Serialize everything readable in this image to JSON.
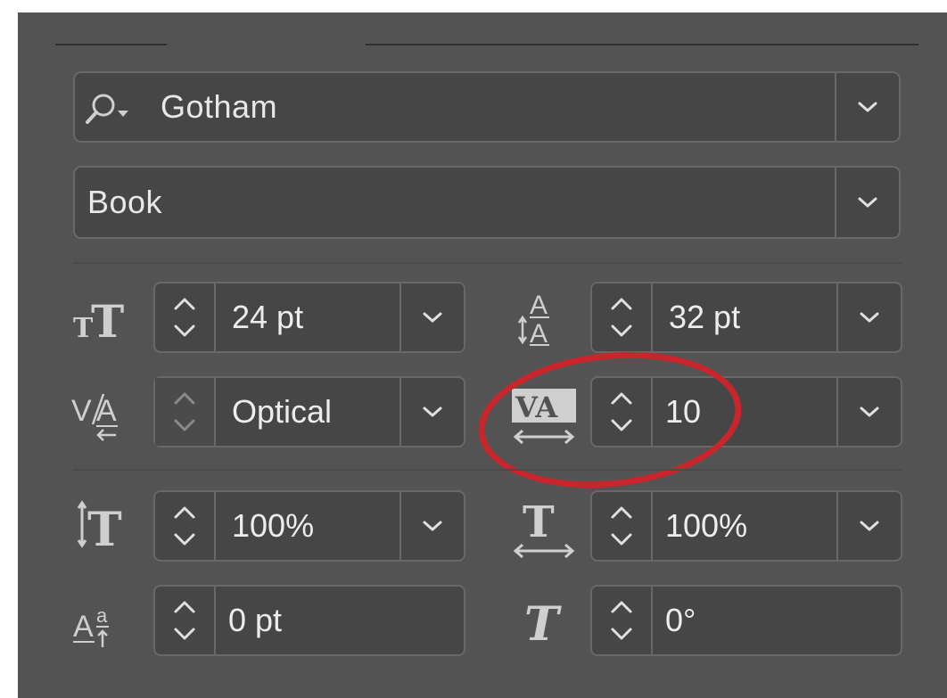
{
  "font_family": {
    "value": "Gotham",
    "icons": {
      "search": "search-dropdown-icon",
      "dropdown": "chevron-down-icon"
    }
  },
  "font_style": {
    "value": "Book"
  },
  "font_size": {
    "value": "24 pt",
    "icon": "font-size-icon"
  },
  "leading": {
    "value": "32 pt",
    "icon": "leading-icon"
  },
  "kerning": {
    "value": "Optical",
    "icon": "kerning-icon"
  },
  "tracking": {
    "value": "10",
    "icon": "tracking-icon"
  },
  "vertical_scale": {
    "value": "100%",
    "icon": "vertical-scale-icon"
  },
  "horizontal_scale": {
    "value": "100%",
    "icon": "horizontal-scale-icon"
  },
  "baseline_shift": {
    "value": "0 pt",
    "icon": "baseline-shift-icon"
  },
  "skew": {
    "value": "0°",
    "icon": "skew-icon"
  },
  "colors": {
    "panel": "#535353",
    "field": "#464646",
    "border": "#686868",
    "text": "#e8e8e8",
    "highlight": "#c8262c"
  }
}
